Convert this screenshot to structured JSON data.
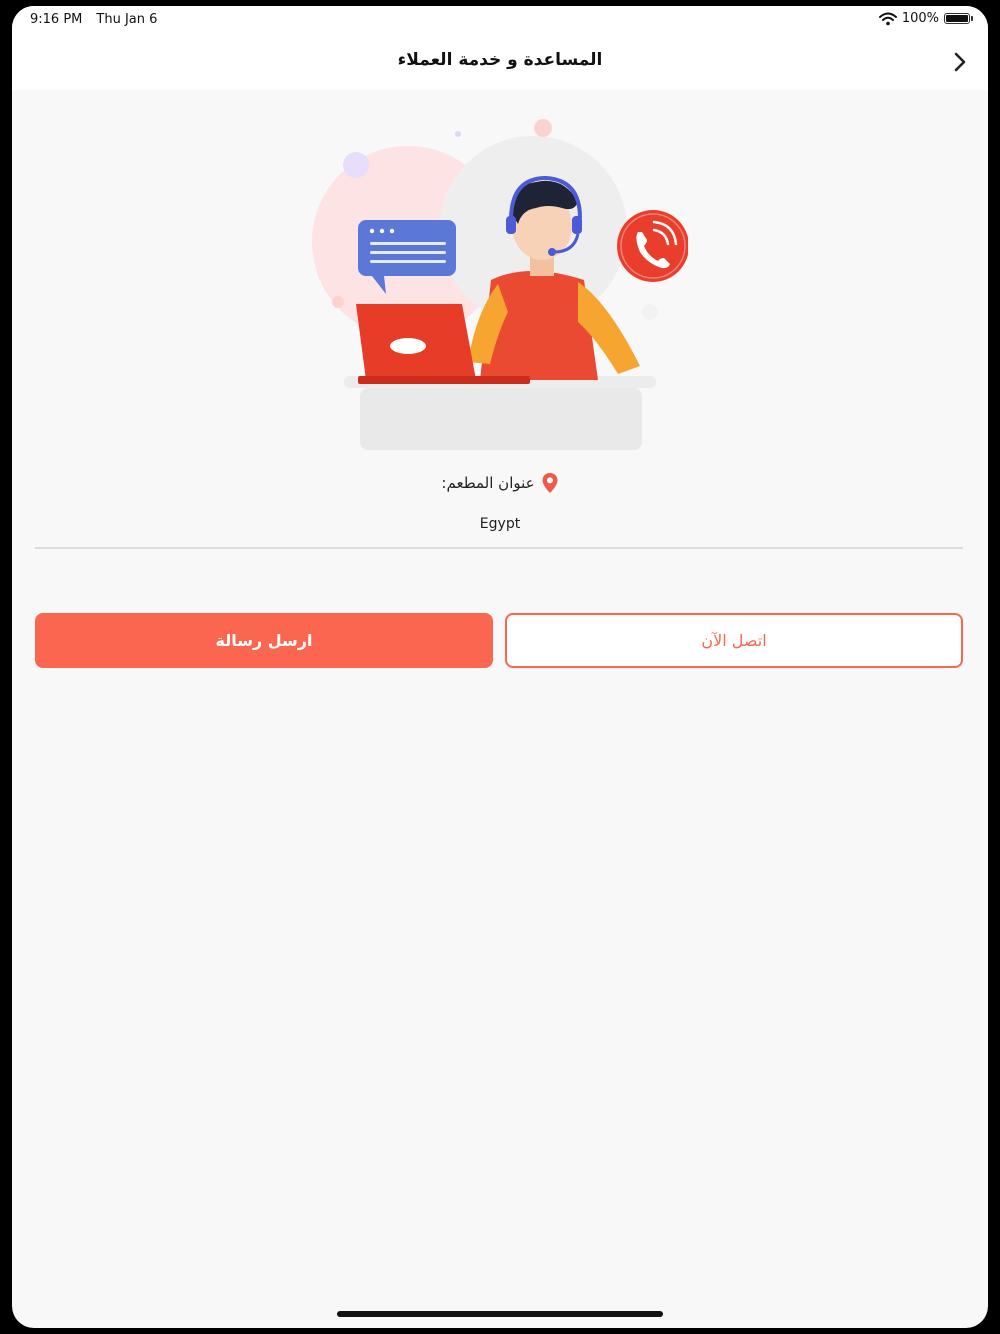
{
  "status_bar": {
    "time": "9:16 PM",
    "date": "Thu Jan 6",
    "battery": "100%"
  },
  "nav": {
    "title": "المساعدة و خدمة العملاء"
  },
  "address": {
    "label": "عنوان المطعم:",
    "value": "Egypt"
  },
  "buttons": {
    "send_message": "ارسل رسالة",
    "call_now": "اتصل الآن"
  },
  "colors": {
    "accent": "#fb6650",
    "background": "#f8f8f8"
  },
  "icons": {
    "back": "chevron-right-icon",
    "location": "map-pin-icon",
    "phone": "phone-icon"
  }
}
